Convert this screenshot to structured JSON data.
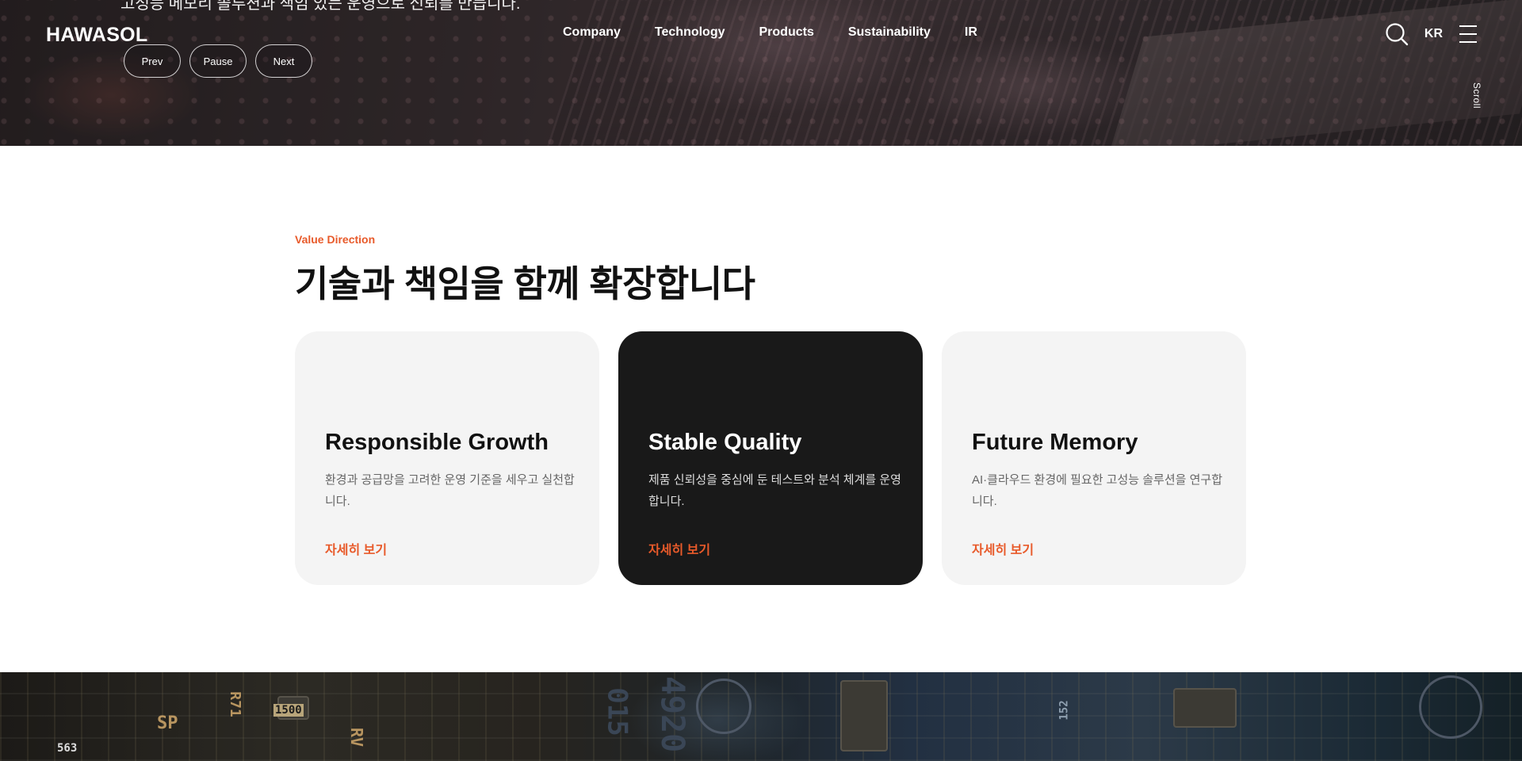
{
  "header": {
    "logo": "HAWASOL",
    "subtitle": "고성능 메모리 솔루션과 책임 있는 운영으로 신뢰를 만듭니다.",
    "nav": [
      "Company",
      "Technology",
      "Products",
      "Sustainability",
      "IR"
    ],
    "lang": "KR",
    "scroll_label": "Scroll"
  },
  "slider": {
    "prev": "Prev",
    "pause": "Pause",
    "next": "Next"
  },
  "value": {
    "eyebrow": "Value Direction",
    "title": "기술과 책임을 함께 확장합니다",
    "cards": [
      {
        "title": "Responsible Growth",
        "desc": "환경과 공급망을 고려한 운영 기준을 세우고 실천합니다.",
        "link": "자세히 보기",
        "theme": "light"
      },
      {
        "title": "Stable Quality",
        "desc": "제품 신뢰성을 중심에 둔 테스트와 분석 체계를 운영합니다.",
        "link": "자세히 보기",
        "theme": "dark"
      },
      {
        "title": "Future Memory",
        "desc": "AI·클라우드 환경에 필요한 고성능 솔루션을 연구합니다.",
        "link": "자세히 보기",
        "theme": "light"
      }
    ]
  },
  "bottom_silkscreen": [
    "SP",
    "R71",
    "1500",
    "563",
    "RV",
    "4920",
    "015",
    "152"
  ],
  "colors": {
    "accent": "#e85a2a",
    "card_light": "#f4f4f4",
    "card_dark": "#191919"
  }
}
